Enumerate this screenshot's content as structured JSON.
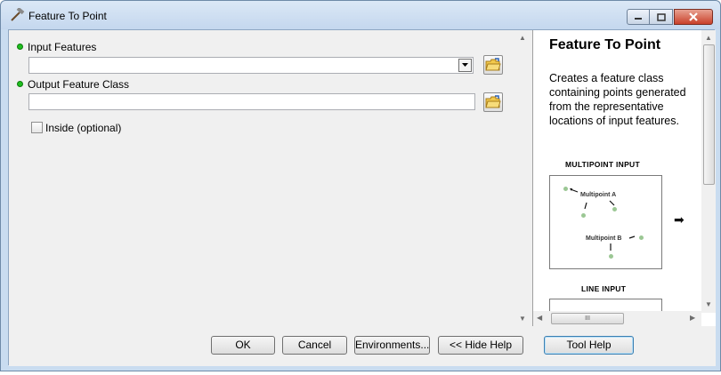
{
  "window": {
    "title": "Feature To Point",
    "icon": "hammer-icon",
    "controls": [
      "minimize-icon",
      "maximize-icon",
      "close-icon"
    ]
  },
  "params": {
    "input_features": {
      "label": "Input Features",
      "value": "",
      "required": true
    },
    "output_feature_class": {
      "label": "Output Feature Class",
      "value": "",
      "required": true
    },
    "inside": {
      "label": "Inside (optional)",
      "checked": false
    }
  },
  "help": {
    "title": "Feature To Point",
    "description": "Creates a feature class containing points generated from the representative locations of input features.",
    "diagram1_heading": "MULTIPOINT INPUT",
    "multipoint_a": "Multipoint A",
    "multipoint_b": "Multipoint B",
    "diagram2_heading": "LINE INPUT",
    "scroll_grip": "III"
  },
  "buttons": {
    "ok": "OK",
    "cancel": "Cancel",
    "environments": "Environments...",
    "hide_help": "<< Hide Help",
    "tool_help": "Tool Help"
  },
  "colors": {
    "required_bullet": "#1fbf1f",
    "close_button": "#c9402a",
    "point": "#9bc794"
  }
}
